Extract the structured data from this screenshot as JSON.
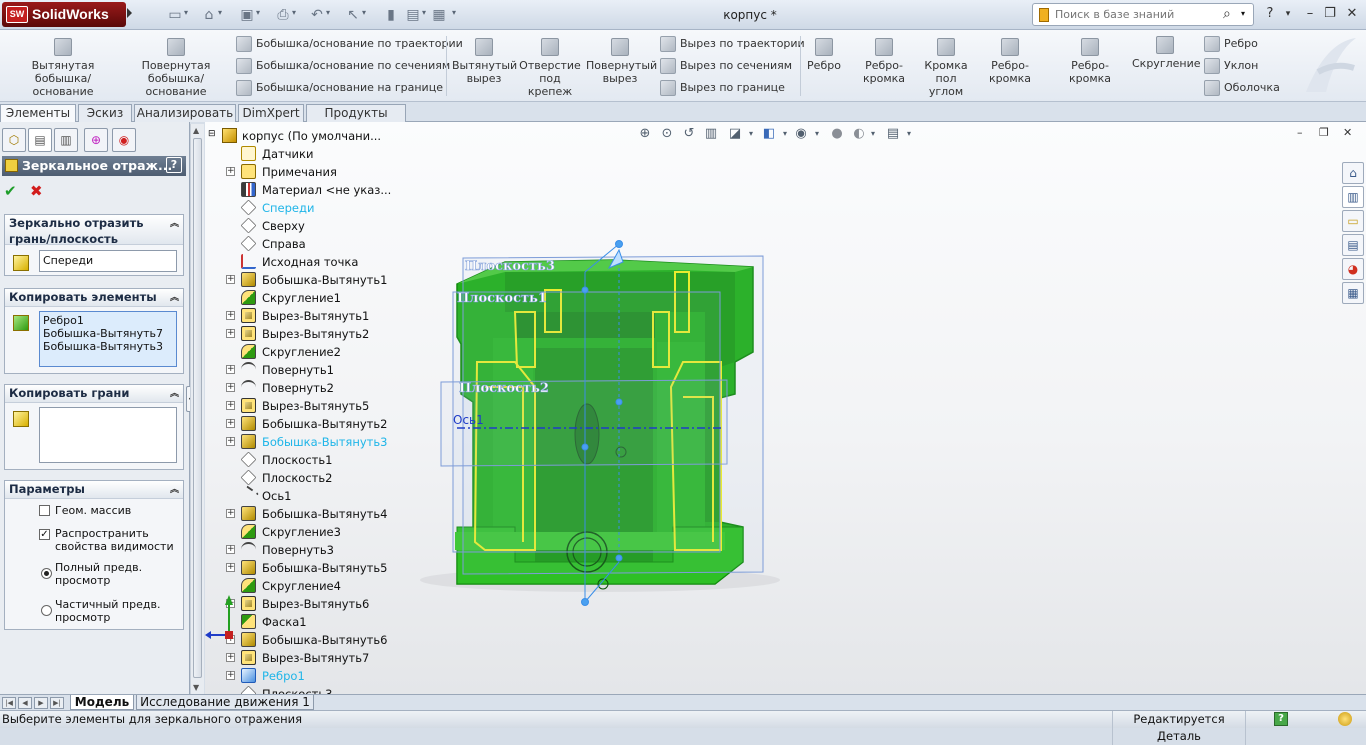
{
  "app": {
    "brand": "SolidWorks",
    "brand_badge": "SW",
    "document_title": "корпус *"
  },
  "quick_access": {
    "icons": [
      "new-icon",
      "open-icon",
      "save-icon",
      "print-icon",
      "undo-icon",
      "select-icon",
      "rebuild-icon",
      "file-properties-icon",
      "options-icon"
    ]
  },
  "search": {
    "placeholder": "Поиск в базе знаний"
  },
  "window_controls": {
    "help": "?",
    "minimize": "–",
    "restore": "❐",
    "close": "✕"
  },
  "command_manager": {
    "big_buttons": [
      {
        "label_1": "Вытянутая",
        "label_2": "бобышка/основание"
      },
      {
        "label_1": "Повернутая",
        "label_2": "бобышка/основание"
      },
      {
        "label_1": "Вытянутый",
        "label_2": "вырез"
      },
      {
        "label_1": "Отверстие",
        "label_2": "под",
        "label_3": "крепеж"
      },
      {
        "label_1": "Повернутый",
        "label_2": "вырез"
      },
      {
        "label_1": "Ребро"
      },
      {
        "label_1": "Ребро-кромка"
      },
      {
        "label_1": "Кромка",
        "label_2": "пол",
        "label_3": "углом"
      },
      {
        "label_1": "Ребро-кромка"
      },
      {
        "label_1": "Ребро-кромка"
      },
      {
        "label_1": "Скругление"
      }
    ],
    "small_buttons": [
      {
        "label": "Бобышка/основание по траектории"
      },
      {
        "label": "Бобышка/основание по сечениям"
      },
      {
        "label": "Бобышка/основание на границе"
      },
      {
        "label": "Вырез по траектории"
      },
      {
        "label": "Вырез по сечениям"
      },
      {
        "label": "Вырез по границе"
      },
      {
        "label": "Ребро"
      },
      {
        "label": "Уклон"
      },
      {
        "label": "Оболочка"
      }
    ]
  },
  "tabs": [
    {
      "label": "Элементы",
      "active": true
    },
    {
      "label": "Эскиз"
    },
    {
      "label": "Анализировать"
    },
    {
      "label": "DimXpert"
    },
    {
      "label": "Продукты Office"
    }
  ],
  "property_manager": {
    "title": "Зеркальное отраж...",
    "help": "?",
    "ok": "✔",
    "cancel": "✖",
    "mirror_face": {
      "header_1": "Зеркально отразить",
      "header_2": "грань/плоскость",
      "value": "Спереди"
    },
    "copy_features": {
      "header": "Копировать элементы",
      "items": [
        "Ребро1",
        "Бобышка-Вытянуть7",
        "Бобышка-Вытянуть3"
      ]
    },
    "copy_faces": {
      "header": "Копировать грани"
    },
    "options": {
      "header": "Параметры",
      "geometry_pattern": {
        "label": "Геом. массив",
        "checked": false
      },
      "propagate": {
        "label_1": "Распространить",
        "label_2": "свойства видимости",
        "checked": true
      },
      "full_preview": {
        "label_1": "Полный предв.",
        "label_2": "просмотр",
        "selected": true
      },
      "partial_preview": {
        "label_1": "Частичный предв.",
        "label_2": "просмотр",
        "selected": false
      }
    }
  },
  "feature_tree": {
    "root": "корпус  (По умолчани...",
    "items": [
      {
        "label": "Датчики",
        "icon": "sensors-icon",
        "expandable": false
      },
      {
        "label": "Примечания",
        "icon": "annotations-icon",
        "expandable": true
      },
      {
        "label": "Материал <не указ...",
        "icon": "material-icon",
        "expandable": false
      },
      {
        "label": "Спереди",
        "icon": "plane-icon",
        "expandable": false,
        "selected": true
      },
      {
        "label": "Сверху",
        "icon": "plane-icon",
        "expandable": false
      },
      {
        "label": "Справа",
        "icon": "plane-icon",
        "expandable": false
      },
      {
        "label": "Исходная точка",
        "icon": "origin-icon",
        "expandable": false
      },
      {
        "label": "Бобышка-Вытянуть1",
        "icon": "boss-extrude-icon",
        "expandable": true
      },
      {
        "label": "Скругление1",
        "icon": "fillet-icon",
        "expandable": false
      },
      {
        "label": "Вырез-Вытянуть1",
        "icon": "cut-extrude-icon",
        "expandable": true
      },
      {
        "label": "Вырез-Вытянуть2",
        "icon": "cut-extrude-icon",
        "expandable": true
      },
      {
        "label": "Скругление2",
        "icon": "fillet-icon",
        "expandable": false
      },
      {
        "label": "Повернуть1",
        "icon": "revolve-icon",
        "expandable": true
      },
      {
        "label": "Повернуть2",
        "icon": "revolve-icon",
        "expandable": true
      },
      {
        "label": "Вырез-Вытянуть5",
        "icon": "cut-extrude-icon",
        "expandable": true
      },
      {
        "label": "Бобышка-Вытянуть2",
        "icon": "boss-extrude-icon",
        "expandable": true
      },
      {
        "label": "Бобышка-Вытянуть3",
        "icon": "boss-extrude-icon",
        "expandable": true,
        "selected": true
      },
      {
        "label": "Плоскость1",
        "icon": "plane-icon",
        "expandable": false
      },
      {
        "label": "Плоскость2",
        "icon": "plane-icon",
        "expandable": false
      },
      {
        "label": "Ось1",
        "icon": "axis-icon",
        "expandable": false
      },
      {
        "label": "Бобышка-Вытянуть4",
        "icon": "boss-extrude-icon",
        "expandable": true
      },
      {
        "label": "Скругление3",
        "icon": "fillet-icon",
        "expandable": false
      },
      {
        "label": "Повернуть3",
        "icon": "revolve-icon",
        "expandable": true
      },
      {
        "label": "Бобышка-Вытянуть5",
        "icon": "boss-extrude-icon",
        "expandable": true
      },
      {
        "label": "Скругление4",
        "icon": "fillet-icon",
        "expandable": false
      },
      {
        "label": "Вырез-Вытянуть6",
        "icon": "cut-extrude-icon",
        "expandable": true
      },
      {
        "label": "Фаска1",
        "icon": "chamfer-icon",
        "expandable": false
      },
      {
        "label": "Бобышка-Вытянуть6",
        "icon": "boss-extrude-icon",
        "expandable": true
      },
      {
        "label": "Вырез-Вытянуть7",
        "icon": "cut-extrude-icon",
        "expandable": true
      },
      {
        "label": "Ребро1",
        "icon": "rib-icon",
        "expandable": true,
        "selected": true
      },
      {
        "label": "Плоскость3",
        "icon": "plane-icon",
        "expandable": false
      }
    ]
  },
  "viewport": {
    "labels": {
      "plane3": "Плоскость3",
      "plane1": "Плоскость1",
      "plane2": "Плоскость2",
      "axis1": "Ось1"
    },
    "colors": {
      "model": "#22b01c",
      "highlight": "#f0f020",
      "plane": "#7d9cd8",
      "axis": "#1f3cc8"
    }
  },
  "bottom_tabs": [
    {
      "label": "Модель",
      "active": true
    },
    {
      "label": "Исследование движения 1"
    }
  ],
  "status": {
    "message": "Выберите элементы для зеркального отражения",
    "mode": "Редактируется Деталь",
    "help": "?"
  }
}
